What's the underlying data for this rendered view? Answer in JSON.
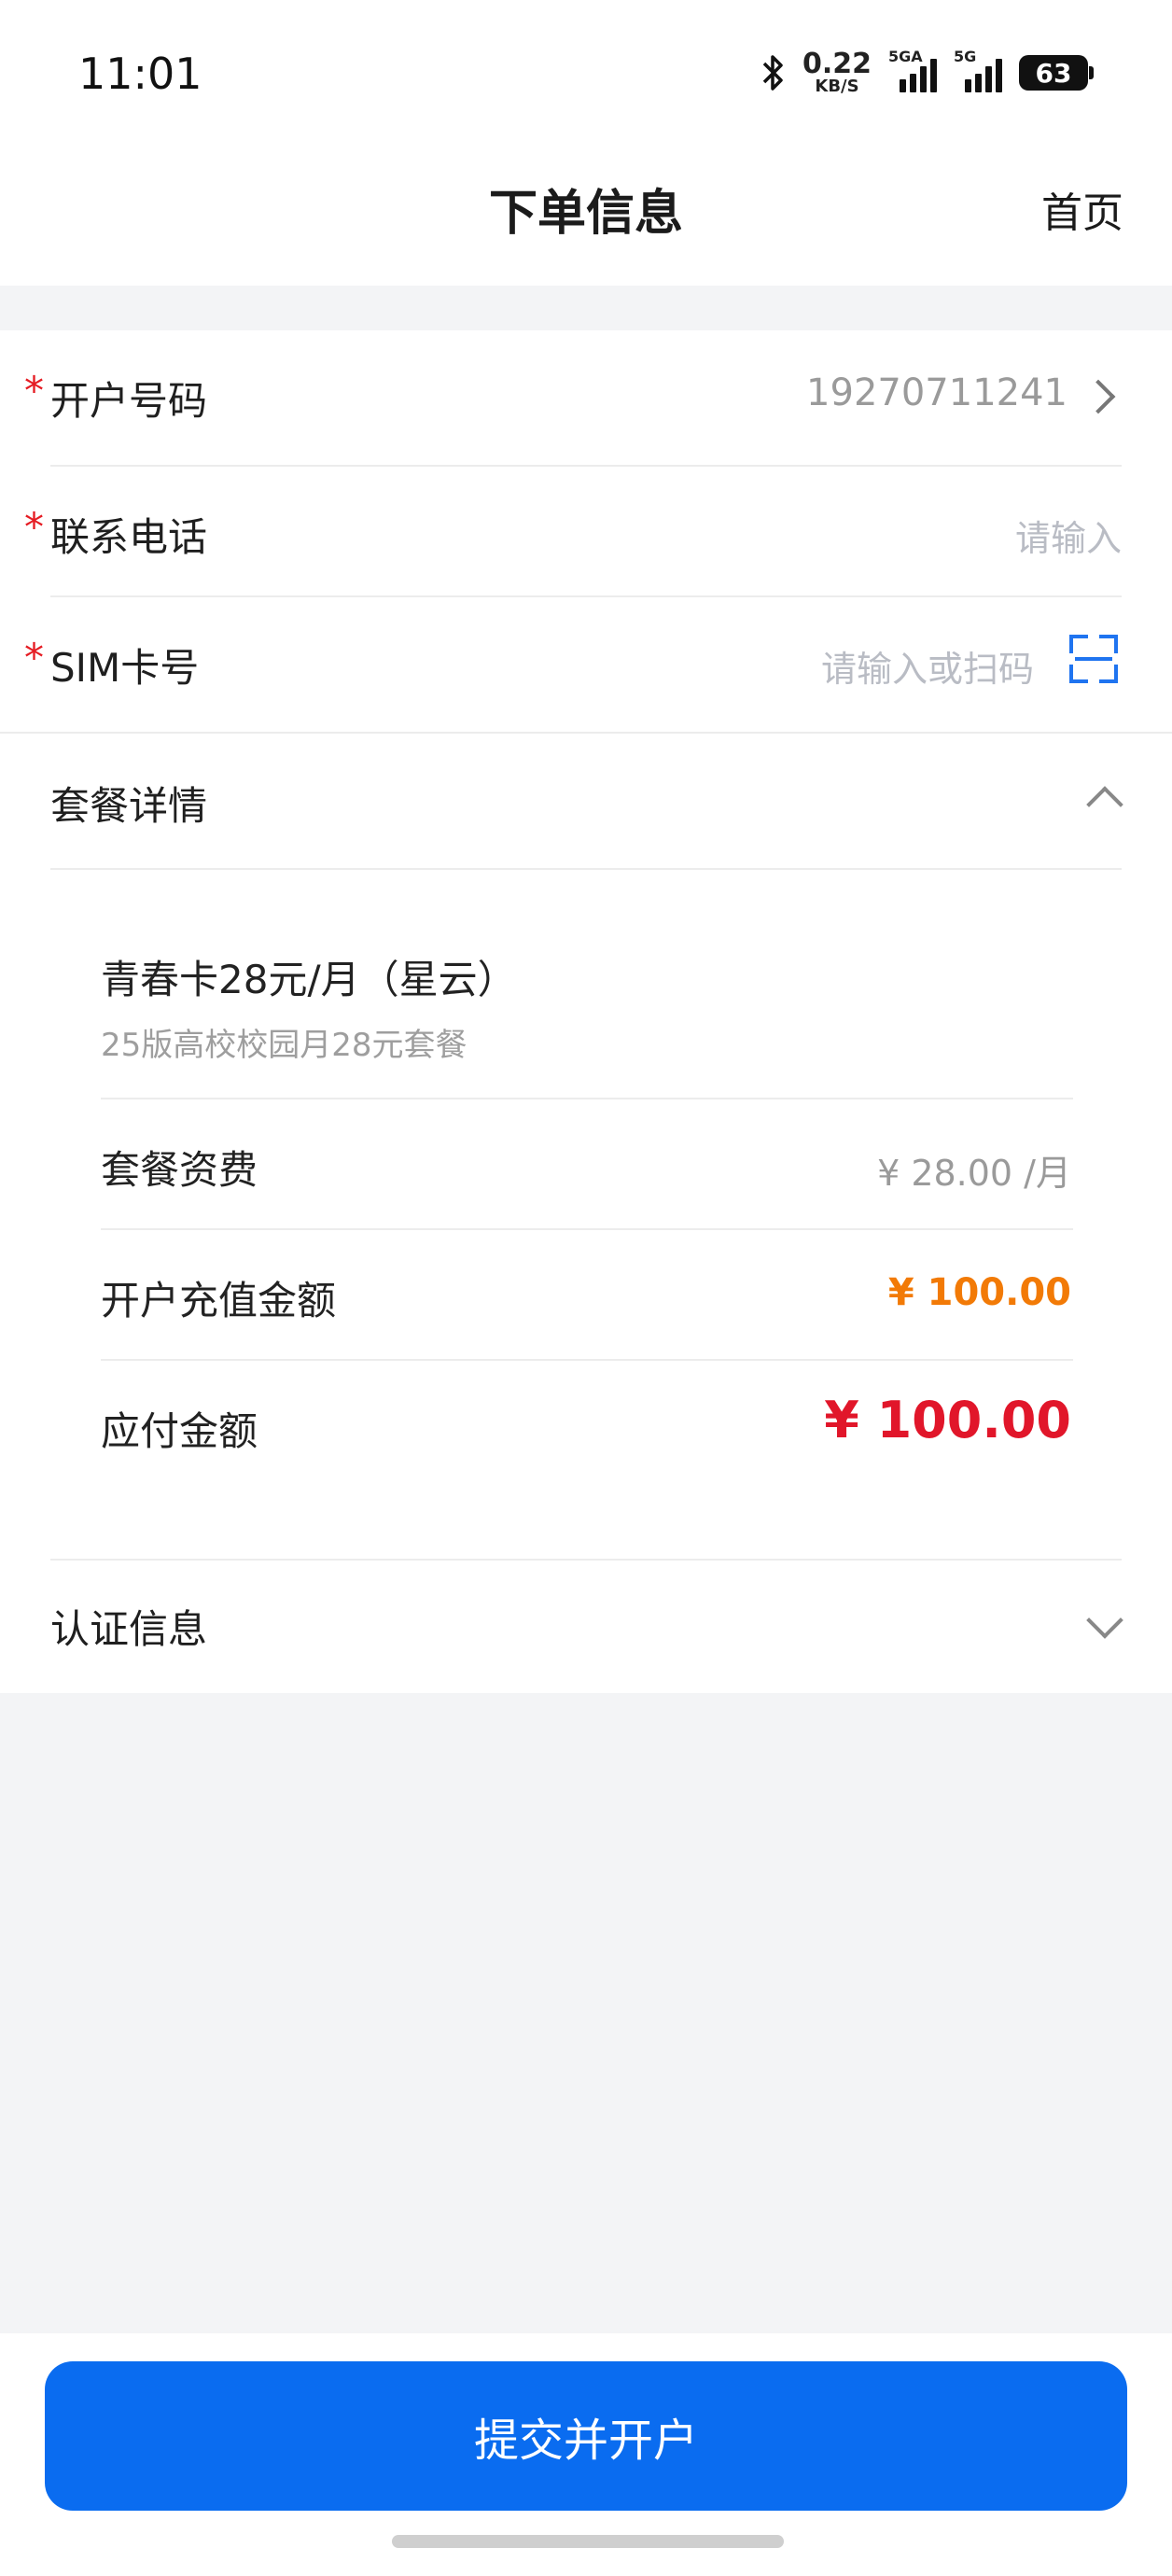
{
  "status_bar": {
    "time": "11:01",
    "net_speed_value": "0.22",
    "net_speed_unit": "KB/S",
    "sim1_label": "5GA",
    "sim2_label": "5G",
    "battery": "63"
  },
  "header": {
    "title": "下单信息",
    "home_label": "首页"
  },
  "form": {
    "account_number": {
      "required": "*",
      "label": "开户号码",
      "value": "19270711241"
    },
    "contact_phone": {
      "required": "*",
      "label": "联系电话",
      "placeholder": "请输入"
    },
    "sim_number": {
      "required": "*",
      "label": "SIM卡号",
      "placeholder": "请输入或扫码"
    }
  },
  "package_section": {
    "title": "套餐详情",
    "package_name": "青春卡28元/月（星云）",
    "package_desc": "25版高校校园月28元套餐",
    "fee_label": "套餐资费",
    "fee_value": "¥ 28.00 /月",
    "recharge_label": "开户充值金额",
    "recharge_value": "¥ 100.00",
    "payable_label": "应付金额",
    "payable_value": "¥ 100.00"
  },
  "auth_section": {
    "title": "认证信息"
  },
  "submit": {
    "label": "提交并开户"
  },
  "colors": {
    "primary": "#0a6cf0",
    "required": "#e51c23",
    "recharge": "#f27a06",
    "payable": "#e1162a"
  },
  "icons": [
    "bluetooth-icon",
    "signal-icon",
    "battery-icon",
    "chevron-right-icon",
    "scan-icon",
    "chevron-up-icon",
    "chevron-down-icon"
  ]
}
